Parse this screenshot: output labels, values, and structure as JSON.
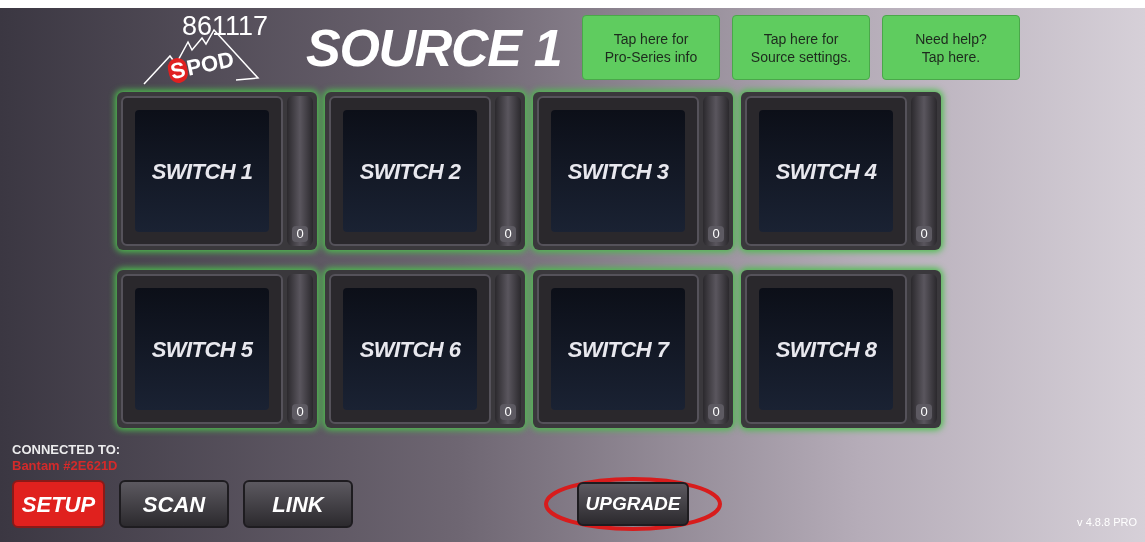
{
  "header": {
    "logo_text": "POD",
    "logo_mark": "S",
    "overlay_number": "861117",
    "title": "SOURCE 1"
  },
  "info_buttons": [
    "Tap here for\nPro-Series info",
    "Tap here for\nSource settings.",
    "Need help?\nTap here."
  ],
  "switches": [
    {
      "label": "SWITCH 1",
      "count": "0"
    },
    {
      "label": "SWITCH 2",
      "count": "0"
    },
    {
      "label": "SWITCH 3",
      "count": "0"
    },
    {
      "label": "SWITCH 4",
      "count": "0"
    },
    {
      "label": "SWITCH 5",
      "count": "0"
    },
    {
      "label": "SWITCH 6",
      "count": "0"
    },
    {
      "label": "SWITCH 7",
      "count": "0"
    },
    {
      "label": "SWITCH 8",
      "count": "0"
    }
  ],
  "connection": {
    "label": "CONNECTED TO:",
    "device": "Bantam #2E621D"
  },
  "bottom_buttons": [
    {
      "label": "SETUP",
      "selected": true
    },
    {
      "label": "SCAN",
      "selected": false
    },
    {
      "label": "LINK",
      "selected": false
    }
  ],
  "upgrade_button": {
    "label": "UPGRADE",
    "circled": true
  },
  "version": "v 4.8.8 PRO"
}
